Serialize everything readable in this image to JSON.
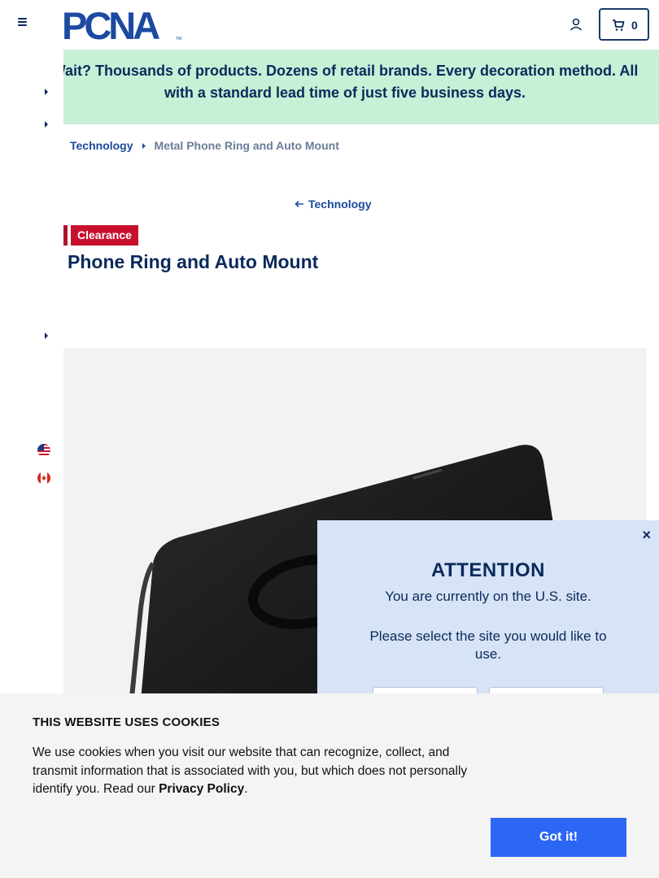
{
  "header": {
    "logo_text": "PCNA",
    "cart_count": "0"
  },
  "promo": {
    "text": "Wait? Thousands of products. Dozens of retail brands. Every decoration method. All with a standard lead time of just five business days."
  },
  "breadcrumb": {
    "items": [
      "Technology",
      "Metal Phone Ring and Auto Mount"
    ]
  },
  "back_link": "Technology",
  "badge": "Clearance",
  "product": {
    "title": "Phone Ring and Auto Mount"
  },
  "attention_modal": {
    "close": "×",
    "heading": "ATTENTION",
    "current_site": "You are currently on the U.S. site.",
    "prompt": "Please select the site you would like to use."
  },
  "cookie_banner": {
    "title": "THIS WEBSITE USES COOKIES",
    "text_before": "We use cookies when you visit our website that can recognize, collect, and transmit information that is associated with you, but which does not personally identify you. Read our ",
    "link": "Privacy Policy",
    "text_after": ".",
    "button": "Got it!"
  },
  "colors": {
    "navy": "#0b2a5b",
    "promo_bg": "#c7f0d6",
    "clearance_red": "#c8102e",
    "modal_bg": "#d7e3f6",
    "cookie_button": "#2c66f5"
  }
}
